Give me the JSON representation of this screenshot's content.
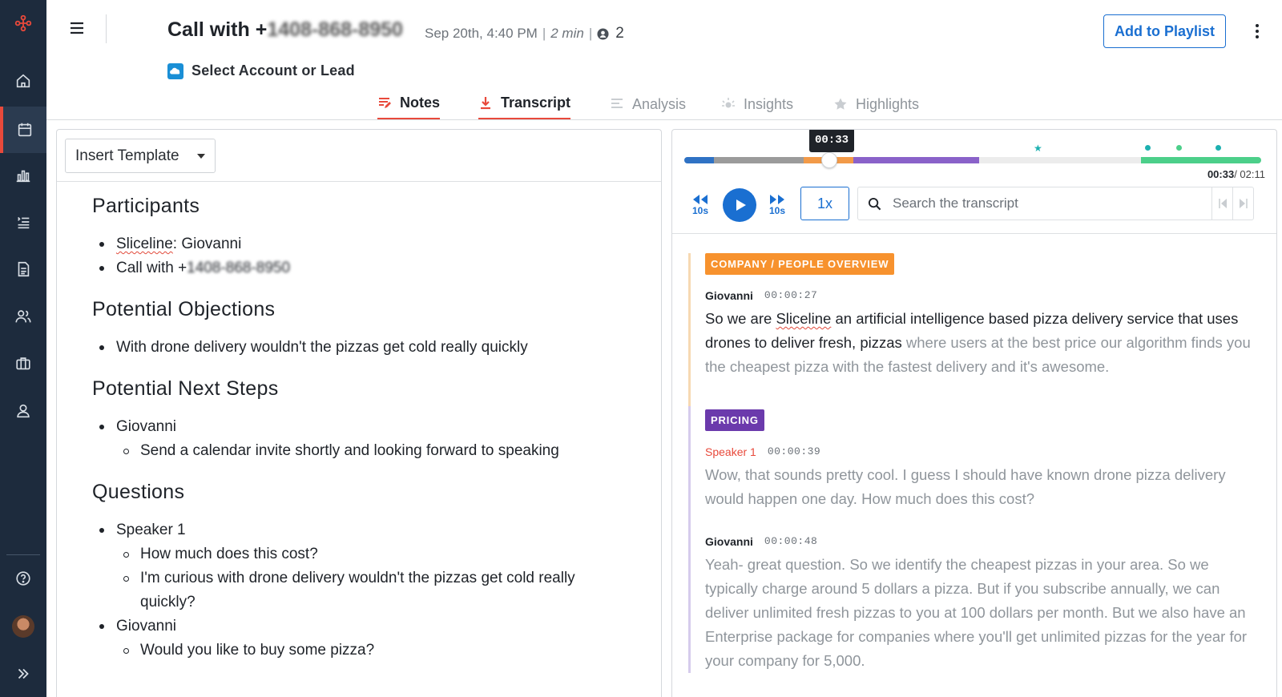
{
  "header": {
    "call_title_prefix": "Call with +",
    "call_title_phone": "1408-868-8950",
    "date": "Sep 20th, 4:40 PM",
    "duration": "2 min",
    "participant_count": "2",
    "account_label": "Select Account or Lead",
    "playlist_button": "Add to Playlist"
  },
  "tabs": [
    {
      "label": "Notes",
      "active": true
    },
    {
      "label": "Transcript",
      "active": true
    },
    {
      "label": "Analysis",
      "active": false
    },
    {
      "label": "Insights",
      "active": false
    },
    {
      "label": "Highlights",
      "active": false
    }
  ],
  "notes": {
    "template_button": "Insert Template",
    "sections": [
      {
        "heading": "Participants",
        "items": [
          {
            "prefix": "Sliceline",
            "text": ": Giovanni"
          },
          {
            "text": "Call with +",
            "phone": "1408-868-8950"
          }
        ]
      },
      {
        "heading": "Potential Objections",
        "items": [
          {
            "text": "With drone delivery wouldn't the pizzas get cold really quickly"
          }
        ]
      },
      {
        "heading": "Potential Next Steps",
        "items": [
          {
            "text": "Giovanni"
          },
          {
            "text": "Send a calendar invite shortly and looking forward to speaking",
            "level": 2
          }
        ]
      },
      {
        "heading": "Questions",
        "items": [
          {
            "text": "Speaker 1"
          },
          {
            "text": "How much does this cost?",
            "level": 2
          },
          {
            "text": "I'm curious with drone delivery wouldn't the pizzas get cold really",
            "level": 2
          },
          {
            "text": "quickly?",
            "level": 2,
            "continuation": true
          },
          {
            "text": "Giovanni"
          },
          {
            "text": "Would you like to buy some pizza?",
            "level": 2
          }
        ]
      }
    ]
  },
  "player": {
    "tooltip_time": "00:33",
    "current_time": "00:33",
    "total_time": "/ 02:11",
    "progress": 0.252,
    "skip_back": "10s",
    "skip_forward": "10s",
    "speed": "1x",
    "search_placeholder": "Search the transcript",
    "colors": {
      "blue": "#2f72c4",
      "grey": "#9b9b9b",
      "orange": "#f29a48",
      "purple": "#8a62c9",
      "green": "#4ccf8a",
      "teal": "#1cb0b0"
    }
  },
  "transcript": {
    "topics": [
      {
        "tag": "COMPANY / PEOPLE OVERVIEW",
        "color": "#f7922e",
        "bar_color": "#f7d9b3",
        "utterances": [
          {
            "speaker": "Giovanni",
            "time": "00:00:27",
            "pre": "So we are ",
            "mark": "Sliceline",
            "text": " an artificial intelligence based pizza delivery service that uses drones to deliver fresh, pizzas",
            "dim": " where users at the best price our algorithm finds you the cheapest pizza with the fastest delivery and it's awesome."
          }
        ]
      },
      {
        "tag": "PRICING",
        "color": "#6b3aac",
        "bar_color": "#d6ccec",
        "utterances": [
          {
            "speaker": "Speaker 1",
            "time": "00:00:39",
            "text": "Wow, that sounds pretty cool. I guess I should have known drone pizza delivery would happen one day. How much does this cost?"
          },
          {
            "speaker": "Giovanni",
            "time": "00:00:48",
            "text": "Yeah- great question. So we identify the cheapest pizzas in your area. So we typically charge around 5 dollars a pizza. But if you subscribe annually, we can deliver unlimited fresh pizzas to you at 100 dollars per month. But we also have an Enterprise package for companies where you'll get unlimited pizzas for the year for your company for 5,000."
          }
        ]
      }
    ]
  }
}
